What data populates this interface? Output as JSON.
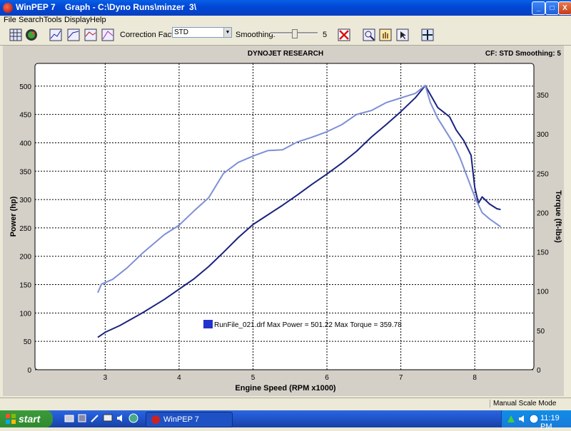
{
  "window": {
    "title": "WinPEP 7    Graph - C:\\Dyno Runs\\minzer  3\\",
    "minimize": "_",
    "maximize": "□",
    "close": "X"
  },
  "menu": [
    "File",
    "Search",
    "Tools",
    "Display",
    "Help"
  ],
  "toolbar": {
    "correction_label": "Correction Factor:",
    "correction_value": "STD",
    "smoothing_label": "Smoothing:",
    "smoothing_value": "5",
    "smoothing_level": 0.5
  },
  "chart_header": {
    "title": "DYNOJET RESEARCH",
    "right": "CF: STD  Smoothing: 5"
  },
  "chart_data": {
    "type": "line",
    "title": "DYNOJET RESEARCH",
    "xlabel": "Engine Speed (RPM x1000)",
    "ylabel": "Power (hp)",
    "y2label": "Torque (ft-lbs)",
    "xlim": [
      2.05,
      8.8
    ],
    "ylim": [
      0,
      540
    ],
    "y2lim": [
      0,
      390
    ],
    "xticks": [
      3,
      4,
      5,
      6,
      7,
      8
    ],
    "yticks": [
      0,
      50,
      100,
      150,
      200,
      250,
      300,
      350,
      400,
      450,
      500
    ],
    "y2ticks": [
      0,
      50,
      100,
      150,
      200,
      250,
      300,
      350
    ],
    "grid": true,
    "series": [
      {
        "name": "Power",
        "axis": "left",
        "color": "#1a237e",
        "x": [
          2.9,
          3.0,
          3.2,
          3.5,
          3.8,
          4.0,
          4.2,
          4.4,
          4.6,
          4.8,
          5.0,
          5.2,
          5.4,
          5.6,
          5.8,
          6.0,
          6.2,
          6.4,
          6.6,
          6.8,
          7.0,
          7.2,
          7.33,
          7.4,
          7.5,
          7.66
        ],
        "values": [
          57,
          66,
          78,
          100,
          124,
          142,
          160,
          182,
          207,
          233,
          256,
          273,
          290,
          308,
          327,
          345,
          364,
          385,
          410,
          432,
          455,
          480,
          501,
          485,
          462,
          446
        ]
      },
      {
        "name": "Torque",
        "axis": "right",
        "color": "#1a237e",
        "x": [
          7.66,
          7.75,
          7.85,
          7.95,
          8.0,
          8.05,
          8.1,
          8.2,
          8.3,
          8.35
        ],
        "values": [
          322,
          305,
          292,
          273,
          232,
          212,
          220,
          211,
          205,
          204
        ]
      },
      {
        "name": "Torque",
        "axis": "right",
        "color": "#7e8fd6",
        "x": [
          2.9,
          2.95,
          3.1,
          3.3,
          3.5,
          3.8,
          4.0,
          4.2,
          4.4,
          4.6,
          4.8,
          5.0,
          5.2,
          5.4,
          5.6,
          5.8,
          6.0,
          6.2,
          6.4,
          6.6,
          6.8,
          7.0,
          7.2,
          7.33,
          7.4,
          7.5,
          7.6,
          7.7,
          7.8,
          7.9,
          8.0,
          8.1,
          8.2,
          8.35
        ],
        "values": [
          98,
          109,
          115,
          130,
          148,
          172,
          184,
          202,
          219,
          250,
          264,
          272,
          279,
          280,
          290,
          296,
          303,
          312,
          325,
          330,
          340,
          346,
          352,
          362,
          340,
          320,
          305,
          290,
          270,
          245,
          220,
          200,
          192,
          182
        ]
      }
    ],
    "annotation": {
      "legend_text": "RunFile_021.drf Max Power = 501.22 Max Torque = 359.78",
      "swatch_color": "#2233cc"
    }
  },
  "statusbar": {
    "text": "Manual Scale Mode"
  },
  "taskbar": {
    "start": "start",
    "task": "WinPEP 7",
    "clock": "11:19 PM"
  }
}
